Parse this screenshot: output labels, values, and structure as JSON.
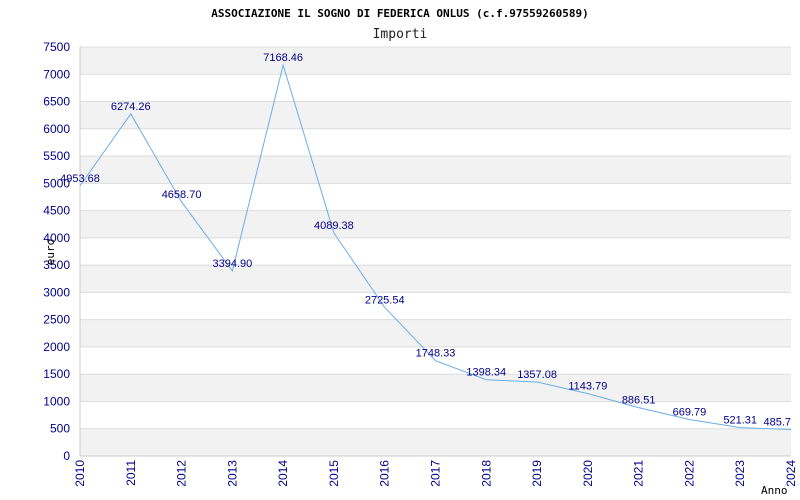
{
  "chart_data": {
    "type": "line",
    "title": "ASSOCIAZIONE IL SOGNO DI FEDERICA ONLUS (c.f.97559260589)",
    "subtitle": "Importi",
    "xlabel": "Anno",
    "ylabel": "euro",
    "x": [
      "2010",
      "2011",
      "2012",
      "2013",
      "2014",
      "2015",
      "2016",
      "2017",
      "2018",
      "2019",
      "2020",
      "2021",
      "2022",
      "2023",
      "2024"
    ],
    "series": [
      {
        "values": [
          4953.68,
          6274.26,
          4658.7,
          3394.9,
          7168.46,
          4089.38,
          2725.54,
          1748.33,
          1398.34,
          1357.08,
          1143.79,
          886.51,
          669.79,
          521.31,
          485.7
        ],
        "labels": [
          "4953.68",
          "6274.26",
          "4658.70",
          "3394.90",
          "7168.46",
          "4089.38",
          "2725.54",
          "1748.33",
          "1398.34",
          "1357.08",
          "1143.79",
          "886.51",
          "669.79",
          "521.31",
          "485.7"
        ]
      }
    ],
    "ylim": [
      0,
      7500
    ],
    "yticks": [
      "0",
      "500",
      "1000",
      "1500",
      "2000",
      "2500",
      "3000",
      "3500",
      "4000",
      "4500",
      "5000",
      "5500",
      "6000",
      "6500",
      "7000",
      "7500"
    ],
    "grid": true,
    "colors": {
      "line": "#6aaee8",
      "band": "#f2f2f2",
      "grid": "#dddddd",
      "tick_text": "#00008b"
    }
  }
}
